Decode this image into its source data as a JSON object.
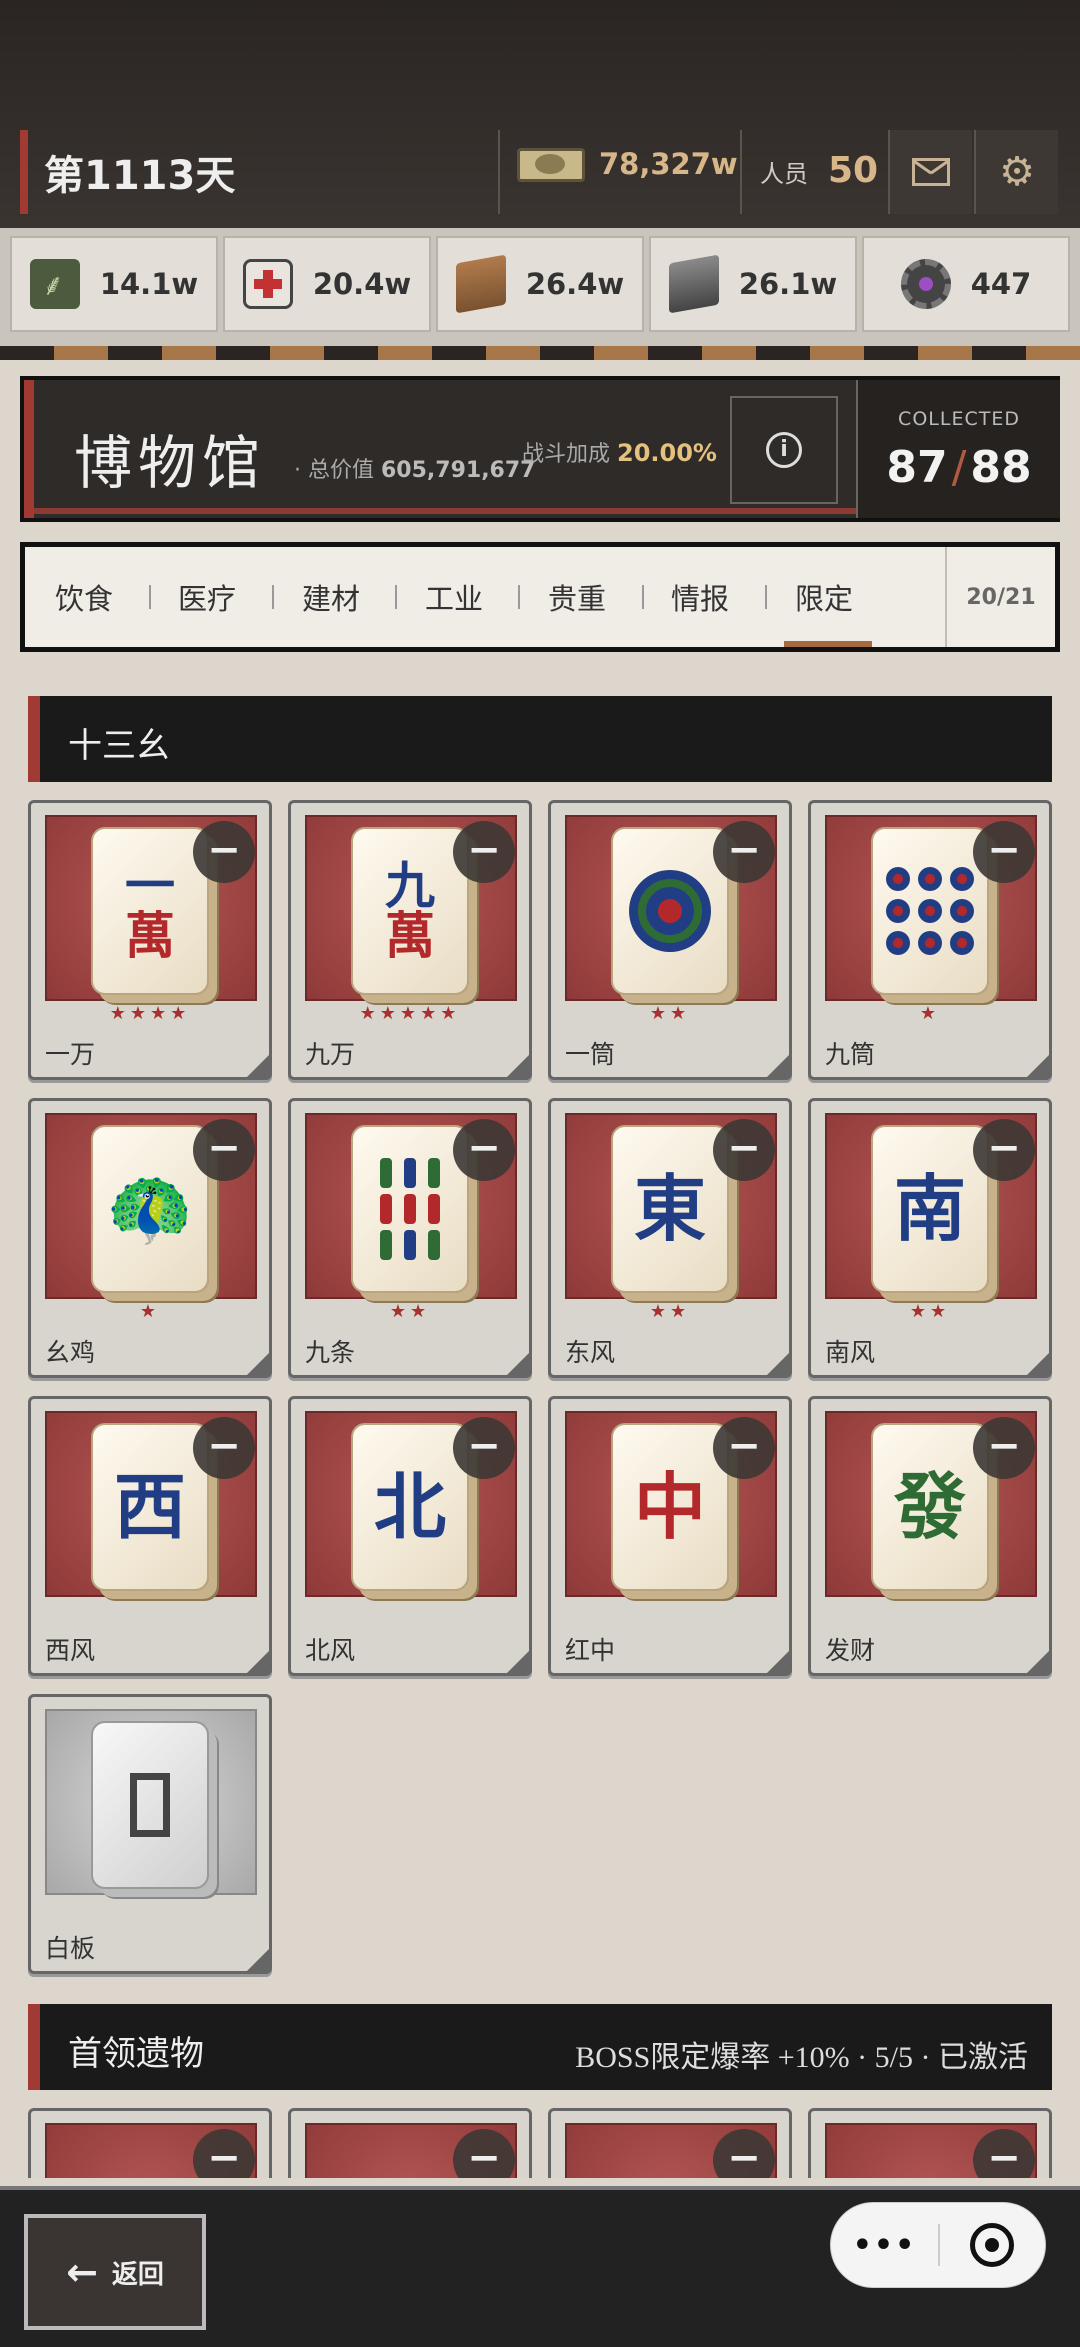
{
  "header": {
    "day_label": "第1113天",
    "money": "78,327w",
    "staff_label": "人员",
    "staff_value": "50",
    "mail_icon": "mail-icon",
    "settings_icon": "gear-icon"
  },
  "resources": [
    {
      "icon": "grain-icon",
      "value": "14.1w"
    },
    {
      "icon": "medkit-icon",
      "value": "20.4w"
    },
    {
      "icon": "brick-icon",
      "value": "26.4w"
    },
    {
      "icon": "steel-icon",
      "value": "26.1w"
    },
    {
      "icon": "gear-part-icon",
      "value": "447"
    }
  ],
  "museum": {
    "title": "博物馆",
    "total_label": "· 总价值",
    "total_value": "605,791,677",
    "bonus_label": "战斗加成",
    "bonus_value": "20.00%",
    "collected_label": "COLLECTED",
    "collected_have": "87",
    "collected_total": "88"
  },
  "tabs": {
    "items": [
      "饮食",
      "医疗",
      "建材",
      "工业",
      "贵重",
      "情报",
      "限定"
    ],
    "active": "限定",
    "count": "20/21"
  },
  "section1": {
    "title": "十三幺",
    "tiles": [
      {
        "name": "一万",
        "stars": "★★★★",
        "glyph_top": "一",
        "glyph_bottom": "萬"
      },
      {
        "name": "九万",
        "stars": "★★★★★",
        "glyph_top": "九",
        "glyph_bottom": "萬"
      },
      {
        "name": "一筒",
        "stars": "★★"
      },
      {
        "name": "九筒",
        "stars": "★"
      },
      {
        "name": "幺鸡",
        "stars": "★"
      },
      {
        "name": "九条",
        "stars": "★★"
      },
      {
        "name": "东风",
        "stars": "★★",
        "glyph": "東"
      },
      {
        "name": "南风",
        "stars": "★★",
        "glyph": "南"
      },
      {
        "name": "西风",
        "stars": "",
        "glyph": "西"
      },
      {
        "name": "北风",
        "stars": "",
        "glyph": "北"
      },
      {
        "name": "红中",
        "stars": "",
        "glyph": "中"
      },
      {
        "name": "发财",
        "stars": "",
        "glyph": "發"
      },
      {
        "name": "白板",
        "stars": ""
      }
    ],
    "remove_symbol": "−"
  },
  "section2": {
    "title": "首领遗物",
    "bonus": "BOSS限定爆率 +10% · 5/5 · 已激活"
  },
  "bottom": {
    "back_label": "返回",
    "more_symbol": "•••"
  }
}
